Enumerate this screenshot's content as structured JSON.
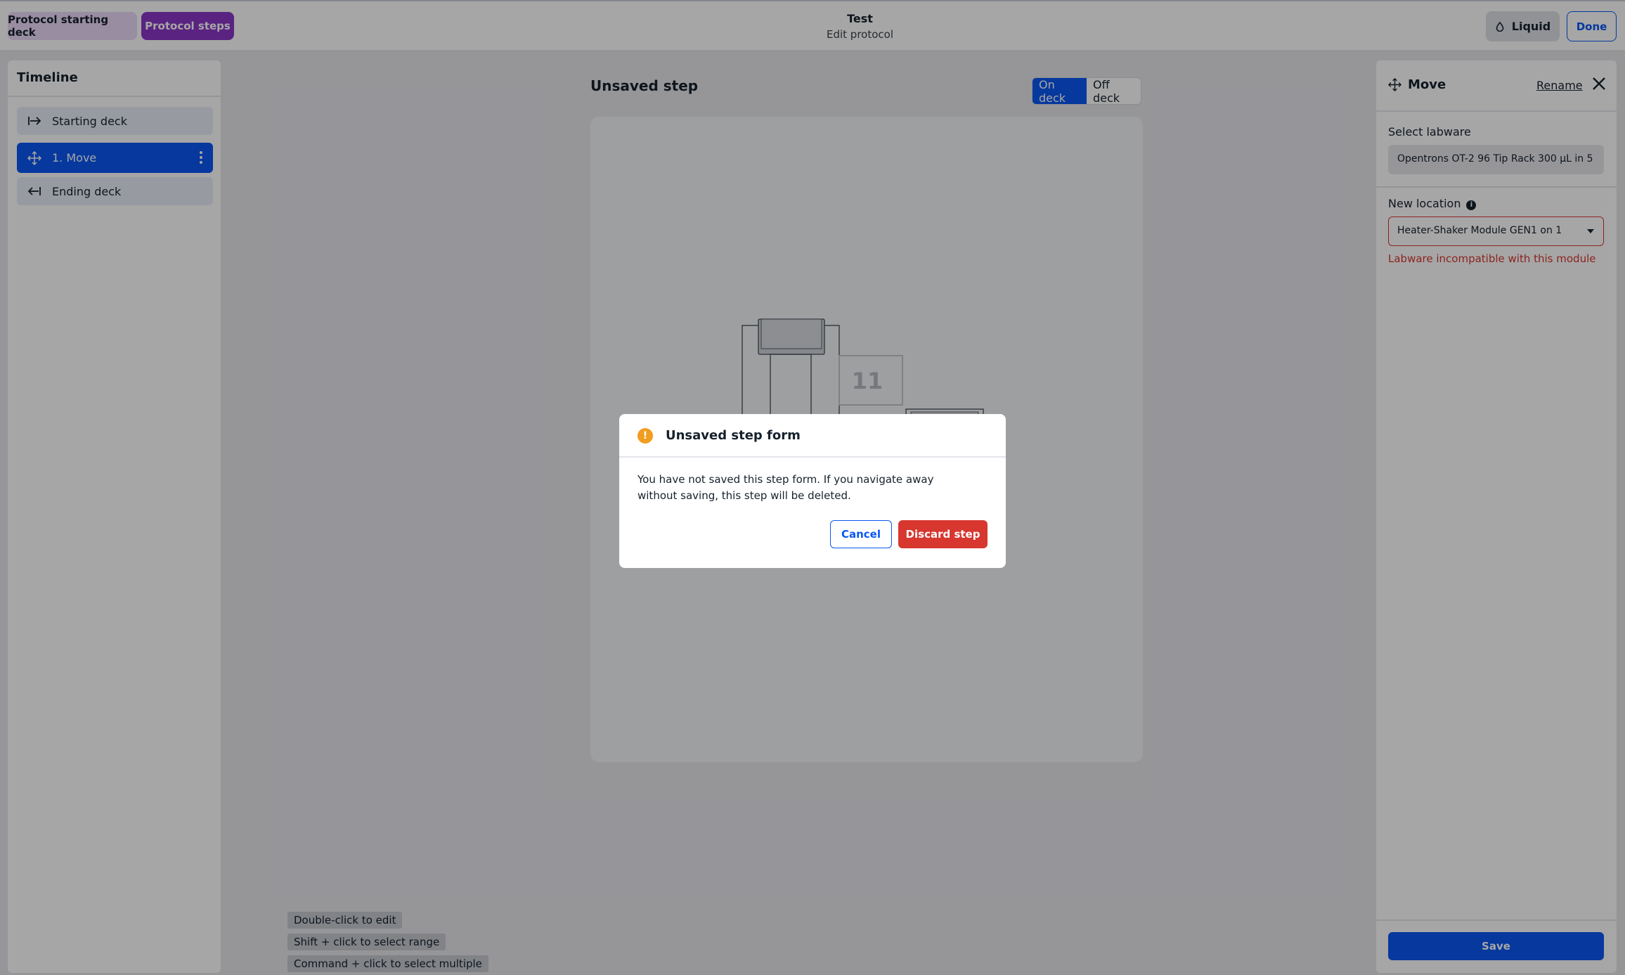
{
  "nav": {
    "tab_starting_deck": "Protocol starting deck",
    "tab_steps": "Protocol steps",
    "protocol_name": "Test",
    "subtitle": "Edit protocol",
    "liquid_label": "Liquid",
    "done_label": "Done"
  },
  "timeline": {
    "title": "Timeline",
    "items": [
      {
        "label": "Starting deck",
        "icon": "arrow-right-to-line-icon"
      },
      {
        "label": "1. Move",
        "icon": "move-icon",
        "selected": true
      },
      {
        "label": "Ending deck",
        "icon": "arrow-left-from-line-icon"
      }
    ]
  },
  "main": {
    "step_title": "Unsaved step",
    "toggle_on": "On deck",
    "toggle_off": "Off deck",
    "deck_slot_label": "11",
    "hints": [
      "Double-click to edit",
      "Shift + click to select range",
      "Command + click to select multiple"
    ]
  },
  "form": {
    "title": "Move",
    "rename": "Rename",
    "labware_label": "Select labware",
    "labware_value": "Opentrons OT-2 96 Tip Rack 300 µL in 5",
    "location_label": "New location",
    "location_value": "Heater-Shaker Module GEN1 on 1",
    "error": "Labware incompatible with this module",
    "save": "Save"
  },
  "modal": {
    "title": "Unsaved step form",
    "body": "You have not saved this step form. If you navigate away without saving, this step will be deleted.",
    "cancel": "Cancel",
    "discard": "Discard step"
  },
  "colors": {
    "primary": "#0a57f2",
    "steps_tab": "#8a37c6",
    "error": "#d7372f",
    "warning": "#f09d20"
  }
}
